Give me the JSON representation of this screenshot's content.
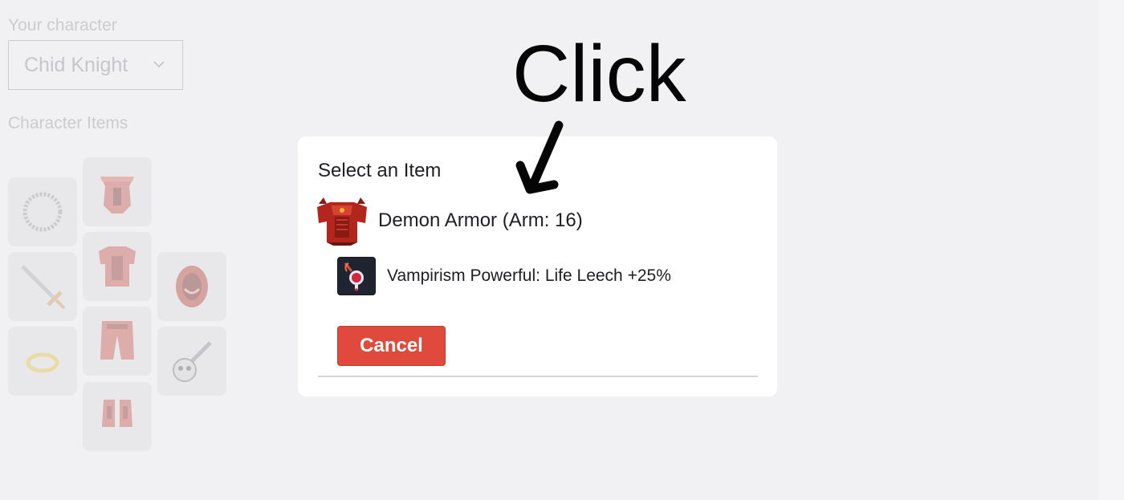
{
  "character_panel": {
    "character_label": "Your character",
    "character_select_value": "Chid Knight",
    "items_label": "Character Items",
    "slots": [
      {
        "name": "slot-amulet",
        "icon": "amulet-icon"
      },
      {
        "name": "slot-helmet",
        "icon": "helmet-icon"
      },
      {
        "name": "slot-weapon",
        "icon": "sword-icon"
      },
      {
        "name": "slot-armor",
        "icon": "armor-icon"
      },
      {
        "name": "slot-shield",
        "icon": "shield-icon"
      },
      {
        "name": "slot-ring",
        "icon": "ring-icon"
      },
      {
        "name": "slot-legs",
        "icon": "legs-icon"
      },
      {
        "name": "slot-ammo",
        "icon": "skull-weapon-icon"
      },
      {
        "name": "slot-boots",
        "icon": "boots-icon"
      }
    ]
  },
  "modal": {
    "title": "Select an Item",
    "item": {
      "name": "Demon Armor (Arm: 16)",
      "icon": "demon-armor-icon"
    },
    "modifier": {
      "text": "Vampirism Powerful: Life Leech +25%",
      "icon": "vampirism-icon"
    },
    "cancel_label": "Cancel"
  },
  "annotation": {
    "text": "Click",
    "icon": "arrow-down-icon"
  },
  "colors": {
    "background": "#f1f1f3",
    "cancel_button": "#e04a3d",
    "armor_red": "#b3261e"
  }
}
